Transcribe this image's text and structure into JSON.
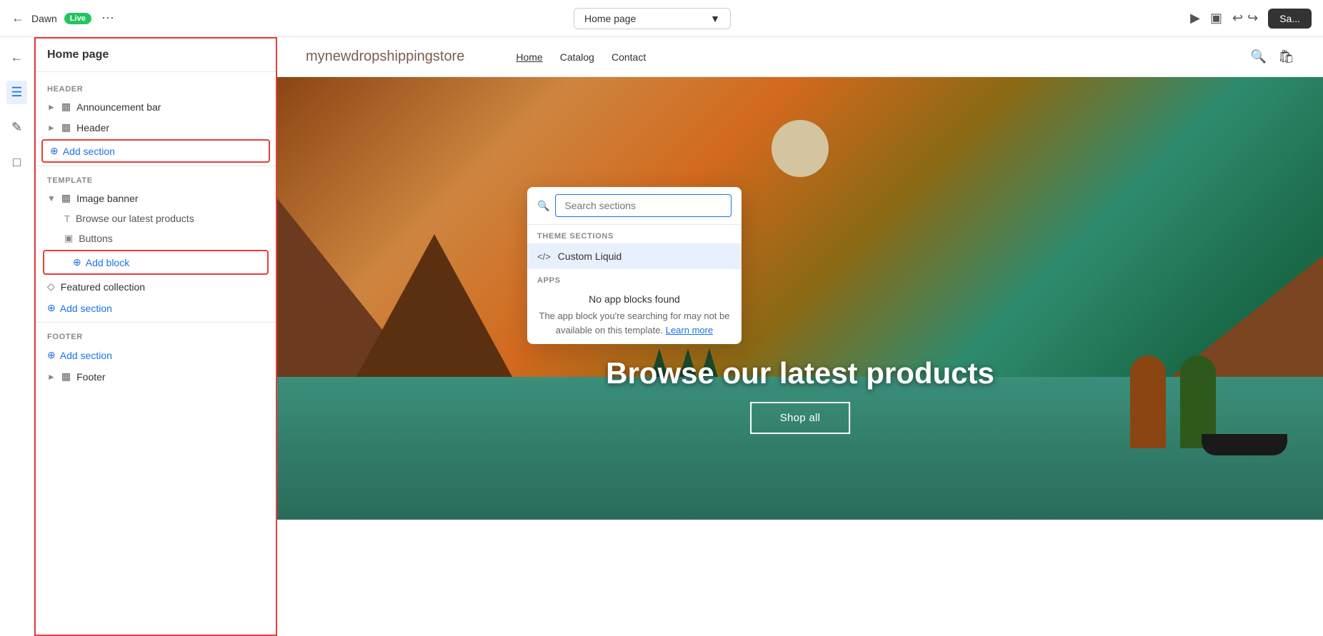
{
  "topbar": {
    "store_name": "Dawn",
    "live_label": "Live",
    "more_label": "···",
    "page_selector_value": "Home page",
    "save_label": "Sa..."
  },
  "panel": {
    "title": "Home page",
    "header_label": "HEADER",
    "announcement_bar_label": "Announcement bar",
    "header_section_label": "Header",
    "add_section_header_label": "Add section",
    "template_label": "TEMPLATE",
    "image_banner_label": "Image banner",
    "browse_latest_label": "Browse our latest products",
    "buttons_label": "Buttons",
    "add_block_label": "Add block",
    "featured_collection_label": "Featured collection",
    "add_section_template_label": "Add section",
    "footer_label": "FOOTER",
    "add_section_footer_label": "Add section",
    "footer_section_label": "Footer"
  },
  "dropdown": {
    "search_placeholder": "Search sections",
    "theme_sections_label": "THEME SECTIONS",
    "custom_liquid_label": "Custom Liquid",
    "apps_label": "APPS",
    "no_apps_title": "No app blocks found",
    "no_apps_desc": "The app block you're searching for may not be available on this template.",
    "learn_more_label": "Learn more"
  },
  "store_preview": {
    "logo": "mynewdropshippingstore",
    "nav_items": [
      "Home",
      "Catalog",
      "Contact"
    ],
    "nav_active": "Home",
    "hero_title": "Browse our latest products",
    "shop_all_label": "Shop all"
  }
}
